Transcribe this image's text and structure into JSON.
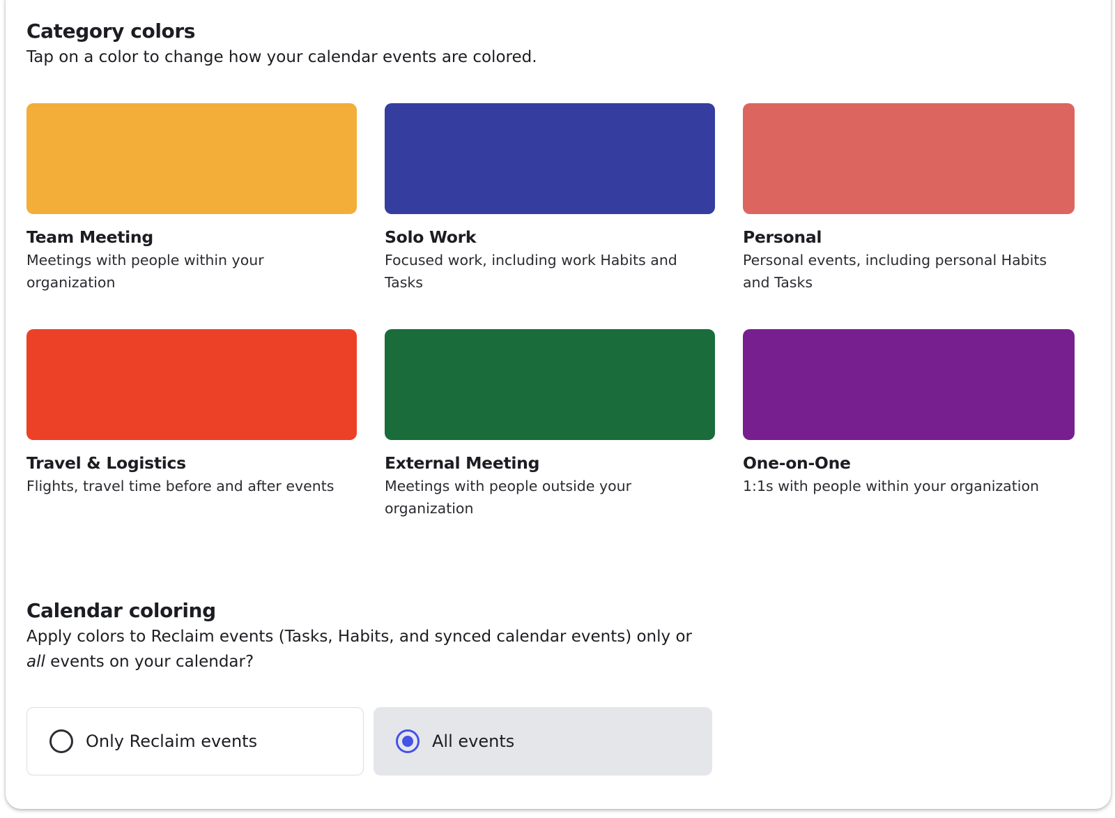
{
  "category_colors": {
    "title": "Category colors",
    "subtitle": "Tap on a color to change how your calendar events are colored.",
    "categories": [
      {
        "name": "Team Meeting",
        "description": "Meetings with people within your organization",
        "color": "#F2AE38"
      },
      {
        "name": "Solo Work",
        "description": "Focused work, including work Habits and Tasks",
        "color": "#353E9E"
      },
      {
        "name": "Personal",
        "description": "Personal events, including personal Habits and Tasks",
        "color": "#DC6560"
      },
      {
        "name": "Travel & Logistics",
        "description": "Flights, travel time before and after events",
        "color": "#ED4127"
      },
      {
        "name": "External Meeting",
        "description": "Meetings with people outside your organization",
        "color": "#1A6C3B"
      },
      {
        "name": "One-on-One",
        "description": "1:1s with people within your organization",
        "color": "#771F8E"
      }
    ]
  },
  "calendar_coloring": {
    "title": "Calendar coloring",
    "description_part1": "Apply colors to Reclaim events (Tasks, Habits, and synced calendar events) only or",
    "description_emphasis": "all",
    "description_part2": " events on your calendar?",
    "options": [
      {
        "label": "Only Reclaim events",
        "selected": false
      },
      {
        "label": "All events",
        "selected": true
      }
    ],
    "accent_color": "#4452E6"
  }
}
